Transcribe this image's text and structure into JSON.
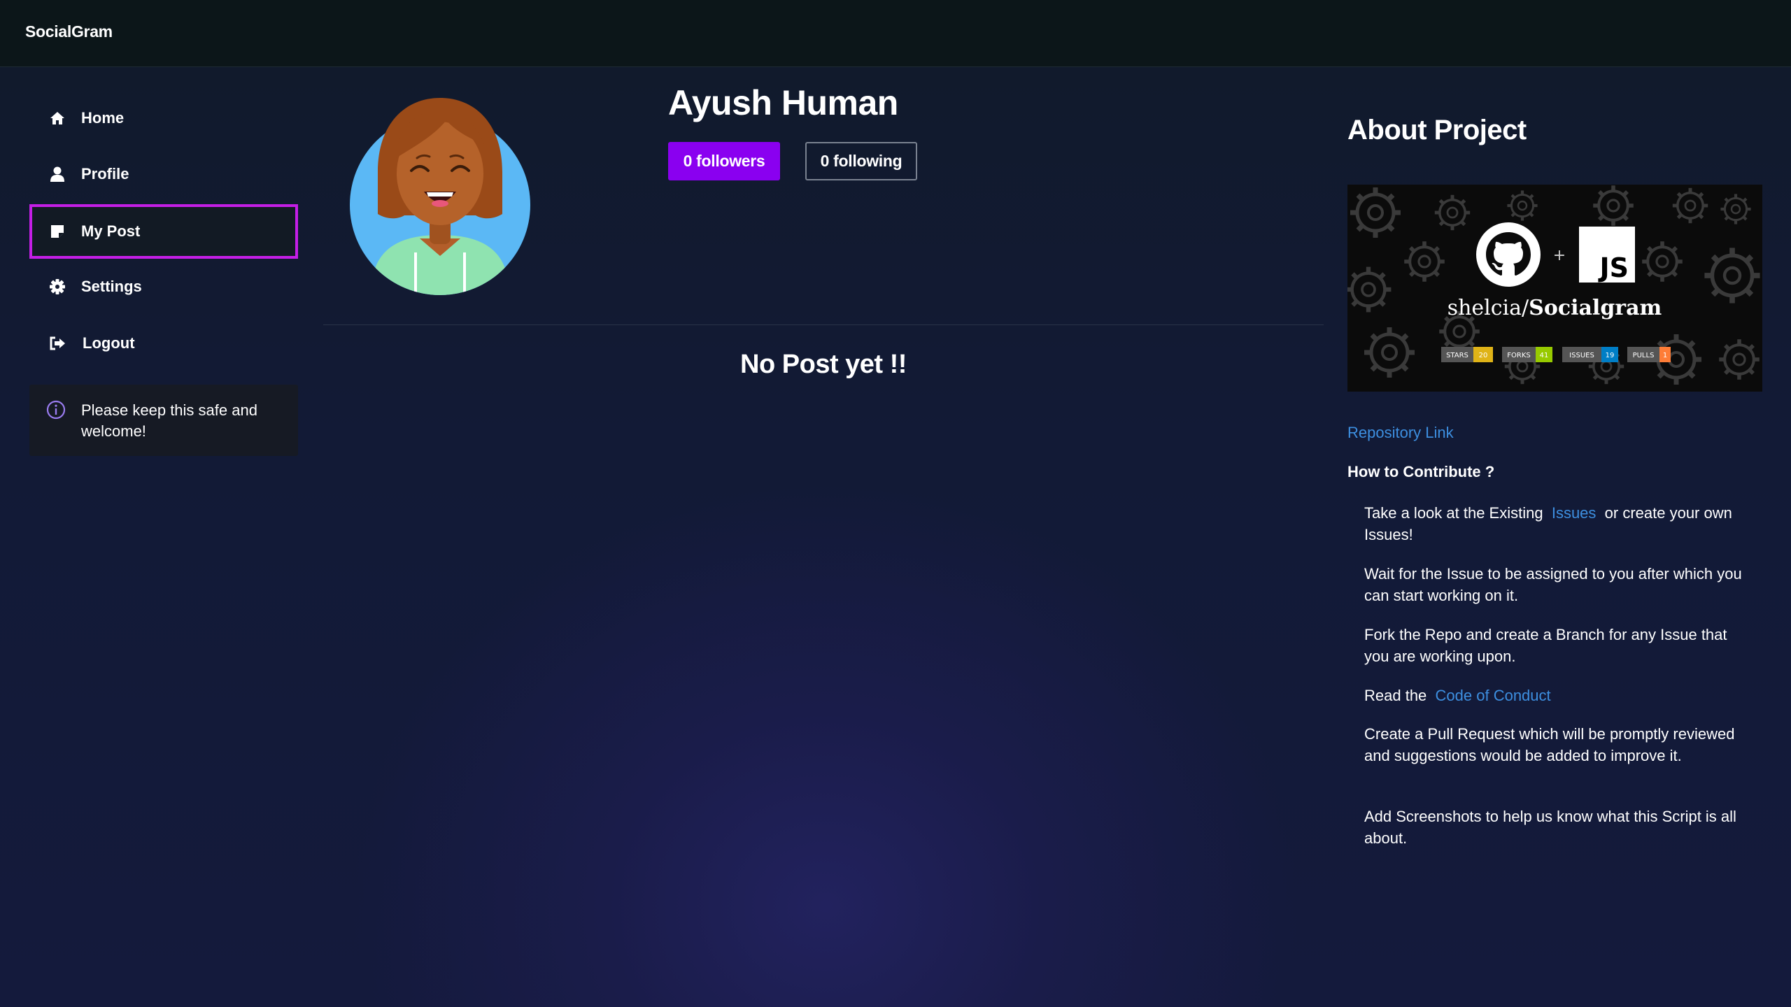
{
  "app": {
    "brand": "SocialGram"
  },
  "sidebar": {
    "items": [
      {
        "label": "Home",
        "icon": "home-icon"
      },
      {
        "label": "Profile",
        "icon": "user-icon"
      },
      {
        "label": "My Post",
        "icon": "note-icon",
        "active": true
      },
      {
        "label": "Settings",
        "icon": "gear-icon"
      },
      {
        "label": "Logout",
        "icon": "logout-icon"
      }
    ],
    "notice": "Please keep this safe and welcome!"
  },
  "profile": {
    "name": "Ayush Human",
    "followers_label": "0 followers",
    "following_label": "0 following"
  },
  "posts": {
    "empty_message": "No Post yet !!"
  },
  "about": {
    "title": "About Project",
    "banner": {
      "repo_owner": "shelcia/",
      "repo_name": "Socialgram",
      "plus": "+",
      "js_label": "JS",
      "badges": [
        {
          "label": "STARS",
          "value": "20",
          "color": "#dfb317"
        },
        {
          "label": "FORKS",
          "value": "41",
          "color": "#97ca00"
        },
        {
          "label": "ISSUES",
          "value": "19",
          "color": "#007ec6"
        },
        {
          "label": "PULLS",
          "value": "1",
          "color": "#fe7d37"
        }
      ]
    },
    "repo_link": "Repository Link",
    "contribute_title": "How to Contribute ?",
    "steps": {
      "s1_pre": "Take a look at the Existing ",
      "s1_link": "Issues",
      "s1_post": " or create your own Issues!",
      "s2": "Wait for the Issue to be assigned to you after which you can start working on it.",
      "s3": "Fork the Repo and create a Branch for any Issue that you are working upon.",
      "s4_pre": "Read the ",
      "s4_link": "Code of Conduct",
      "s5": "Create a Pull Request which will be promptly reviewed and suggestions would be added to improve it.",
      "s6": "Add Screenshots to help us know what this Script is all about."
    }
  },
  "colors": {
    "accent_purple": "#8a00f0",
    "active_border": "#c41ee6",
    "link_blue": "#3d8fe0"
  }
}
